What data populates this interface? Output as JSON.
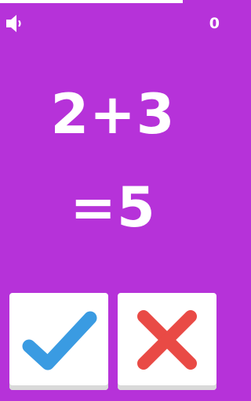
{
  "timer": {
    "remaining_fraction": 0.81,
    "color": "#ffffff"
  },
  "header": {
    "sound_icon": "speaker-icon",
    "score": "0"
  },
  "equation": {
    "expression": "2+3",
    "result": "=5"
  },
  "answers": {
    "correct_icon": "check-icon",
    "wrong_icon": "x-icon"
  },
  "colors": {
    "background": "#b632d9",
    "check": "#3a9be2",
    "cross": "#e94a45",
    "button": "#ffffff"
  }
}
